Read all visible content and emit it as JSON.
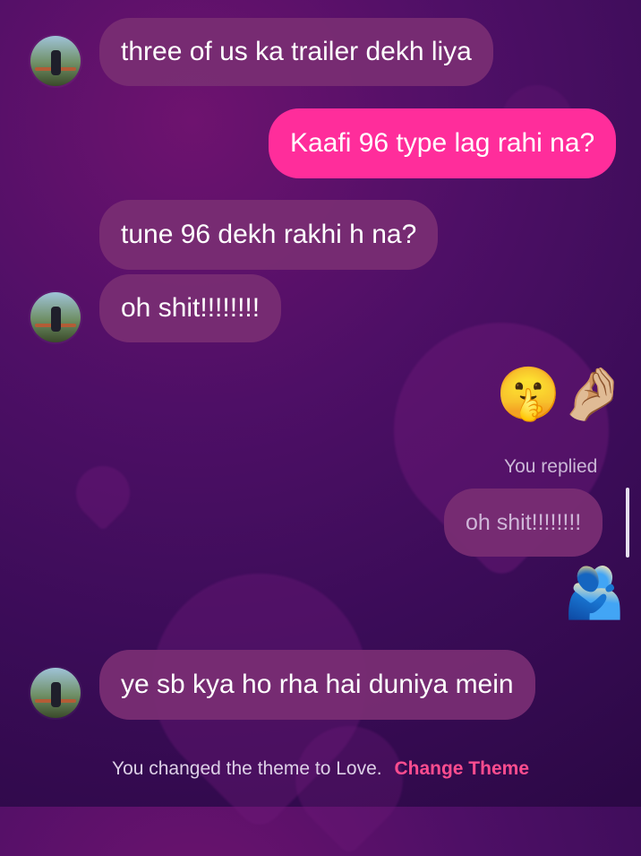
{
  "messages": [
    {
      "type": "received",
      "text": "three of us ka trailer dekh liya"
    },
    {
      "type": "sent",
      "text": "Kaafi 96 type lag rahi na?"
    },
    {
      "type": "received",
      "text": "tune 96 dekh rakhi h na?"
    },
    {
      "type": "received",
      "text": "oh shit!!!!!!!!"
    },
    {
      "type": "sent",
      "text": "🤫🤌🏼"
    },
    {
      "type": "meta",
      "text": "You replied"
    },
    {
      "type": "replied",
      "text": "oh shit!!!!!!!!"
    },
    {
      "type": "sent",
      "text": "🫂"
    },
    {
      "type": "received",
      "text": "ye sb kya ho rha hai duniya mein"
    }
  ],
  "system": {
    "theme_text": "You changed the theme to Love.",
    "change_link": "Change Theme"
  },
  "colors": {
    "sent_bubble": "#ff2d9b",
    "received_bubble": "#782d73",
    "link": "#ff4d8f"
  },
  "icons": {
    "avatar": "profile-avatar-icon",
    "shush": "shushing-face-emoji",
    "pinched": "pinched-fingers-emoji",
    "hug": "people-hugging-emoji"
  }
}
